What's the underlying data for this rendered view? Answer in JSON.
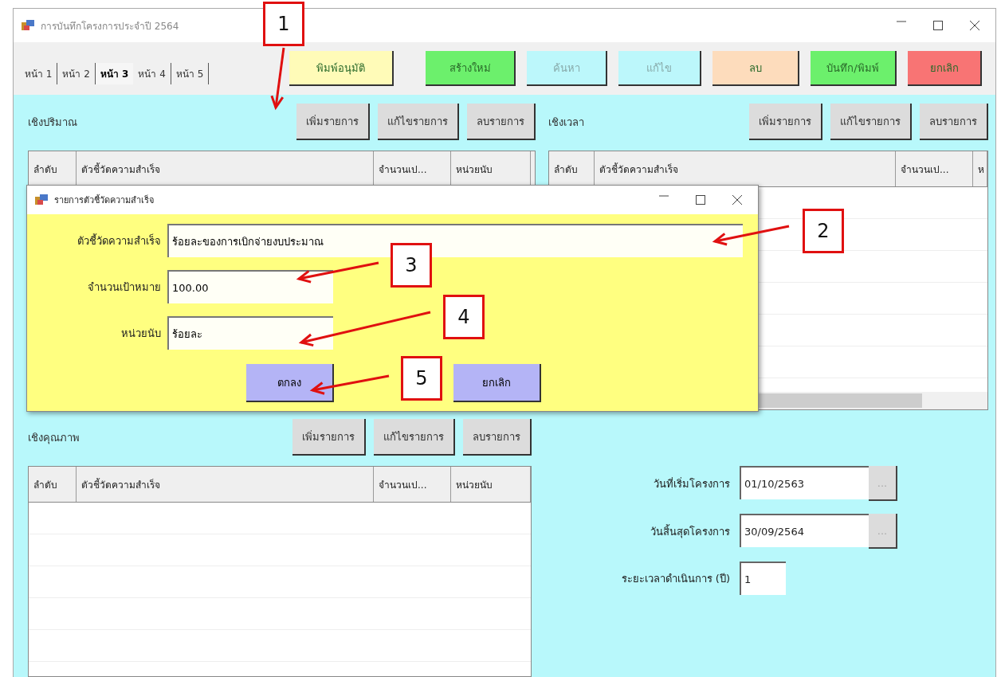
{
  "window": {
    "title": "การบันทึกโครงการประจำปี 2564"
  },
  "tabs": [
    {
      "label": "หน้า 1",
      "selected": false
    },
    {
      "label": "หน้า 2",
      "selected": false
    },
    {
      "label": "หน้า 3",
      "selected": true
    },
    {
      "label": "หน้า 4",
      "selected": false
    },
    {
      "label": "หน้า 5",
      "selected": false
    }
  ],
  "toolbar": [
    {
      "label": "พิมพ์อนุมัติ",
      "color": "#fffbb8",
      "disabled": false
    },
    {
      "label": "สร้างใหม่",
      "color": "#6cf06c",
      "disabled": false
    },
    {
      "label": "ค้นหา",
      "color": "#bcf7fb",
      "disabled": true
    },
    {
      "label": "แก้ไข",
      "color": "#bcf7fb",
      "disabled": true
    },
    {
      "label": "ลบ",
      "color": "#fddcbc",
      "disabled": false
    },
    {
      "label": "บันทึก/พิมพ์",
      "color": "#6cf06c",
      "disabled": false
    },
    {
      "label": "ยกเลิก",
      "color": "#f87474",
      "disabled": false
    }
  ],
  "sections": [
    {
      "title": "เชิงปริมาณ",
      "buttons": [
        "เพิ่มรายการ",
        "แก้ไขรายการ",
        "ลบรายการ"
      ],
      "columns": [
        "ลำดับ",
        "ตัวชี้วัดความสำเร็จ",
        "จำนวนเป...",
        "หน่วยนับ"
      ]
    },
    {
      "title": "เชิงเวลา",
      "buttons": [
        "เพิ่มรายการ",
        "แก้ไขรายการ",
        "ลบรายการ"
      ],
      "columns": [
        "ลำดับ",
        "ตัวชี้วัดความสำเร็จ",
        "จำนวนเป...",
        "ห"
      ]
    },
    {
      "title": "เชิงคุณภาพ",
      "buttons": [
        "เพิ่มรายการ",
        "แก้ไขรายการ",
        "ลบรายการ"
      ],
      "columns": [
        "ลำดับ",
        "ตัวชี้วัดความสำเร็จ",
        "จำนวนเป...",
        "หน่วยนับ"
      ]
    }
  ],
  "dates": [
    {
      "label": "วันที่เริ่มโครงการ",
      "value": "01/10/2563",
      "picker": "..."
    },
    {
      "label": "วันสิ้นสุดโครงการ",
      "value": "30/09/2564",
      "picker": "..."
    },
    {
      "label": "ระยะเวลาดำเนินการ (ปี)",
      "value": "1"
    }
  ],
  "dialog": {
    "title": "รายการตัวชี้วัดความสำเร็จ",
    "fields": [
      {
        "label": "ตัวชี้วัดความสำเร็จ",
        "value": "ร้อยละของการเบิกจ่ายงบประมาณ"
      },
      {
        "label": "จำนวนเป้าหมาย",
        "value": "100.00"
      },
      {
        "label": "หน่วยนับ",
        "value": "ร้อยละ"
      }
    ],
    "buttons": [
      "ตกลง",
      "ยกเลิก"
    ]
  },
  "annotations": [
    {
      "label": "1"
    },
    {
      "label": "2"
    },
    {
      "label": "3"
    },
    {
      "label": "4"
    },
    {
      "label": "5"
    }
  ]
}
